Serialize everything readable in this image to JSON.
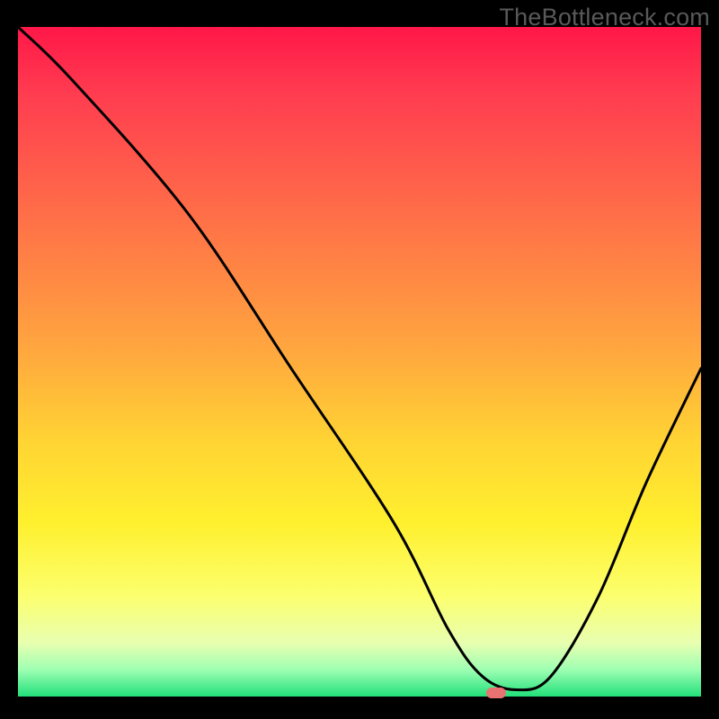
{
  "watermark": "TheBottleneck.com",
  "chart_data": {
    "type": "line",
    "title": "",
    "xlabel": "",
    "ylabel": "",
    "xlim": [
      0,
      100
    ],
    "ylim": [
      0,
      100
    ],
    "x": [
      0,
      8,
      25,
      40,
      55,
      63,
      68,
      73,
      78,
      85,
      92,
      100
    ],
    "values": [
      100,
      92,
      72,
      49,
      26,
      10,
      3,
      1,
      3,
      15,
      32,
      49
    ],
    "marker": {
      "x": 70,
      "y": 0.5
    },
    "background_gradient_stops": [
      {
        "pos": 0,
        "color": "#ff1748"
      },
      {
        "pos": 30,
        "color": "#ff7447"
      },
      {
        "pos": 62,
        "color": "#ffd433"
      },
      {
        "pos": 85,
        "color": "#fcff6e"
      },
      {
        "pos": 100,
        "color": "#22e07a"
      }
    ]
  }
}
